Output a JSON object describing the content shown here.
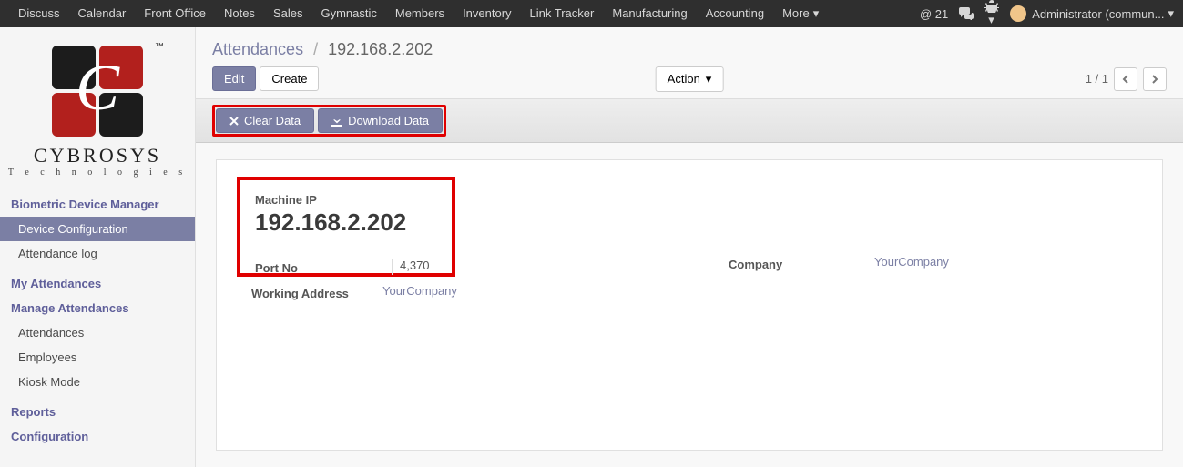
{
  "topnav": {
    "items": [
      "Discuss",
      "Calendar",
      "Front Office",
      "Notes",
      "Sales",
      "Gymnastic",
      "Members",
      "Inventory",
      "Link Tracker",
      "Manufacturing",
      "Accounting"
    ],
    "more": "More",
    "msg_count": "21",
    "user": "Administrator (commun..."
  },
  "logo": {
    "tm": "™",
    "name": "CYBROSYS",
    "tag": "T e c h n o l o g i e s"
  },
  "sidebar": {
    "section_bdm": "Biometric Device Manager",
    "bdm_items": [
      "Device Configuration",
      "Attendance log"
    ],
    "section_my": "My Attendances",
    "section_manage": "Manage Attendances",
    "manage_items": [
      "Attendances",
      "Employees",
      "Kiosk Mode"
    ],
    "section_reports": "Reports",
    "section_config": "Configuration"
  },
  "breadcrumb": {
    "root": "Attendances",
    "current": "192.168.2.202"
  },
  "controls": {
    "edit": "Edit",
    "create": "Create",
    "action": "Action",
    "pager": "1 / 1"
  },
  "statusbar": {
    "clear": "Clear Data",
    "download": "Download Data"
  },
  "record": {
    "machine_ip_label": "Machine IP",
    "machine_ip": "192.168.2.202",
    "port_label": "Port No",
    "port": "4,370",
    "company_label": "Company",
    "company": "YourCompany",
    "addr_label": "Working Address",
    "addr": "YourCompany"
  }
}
